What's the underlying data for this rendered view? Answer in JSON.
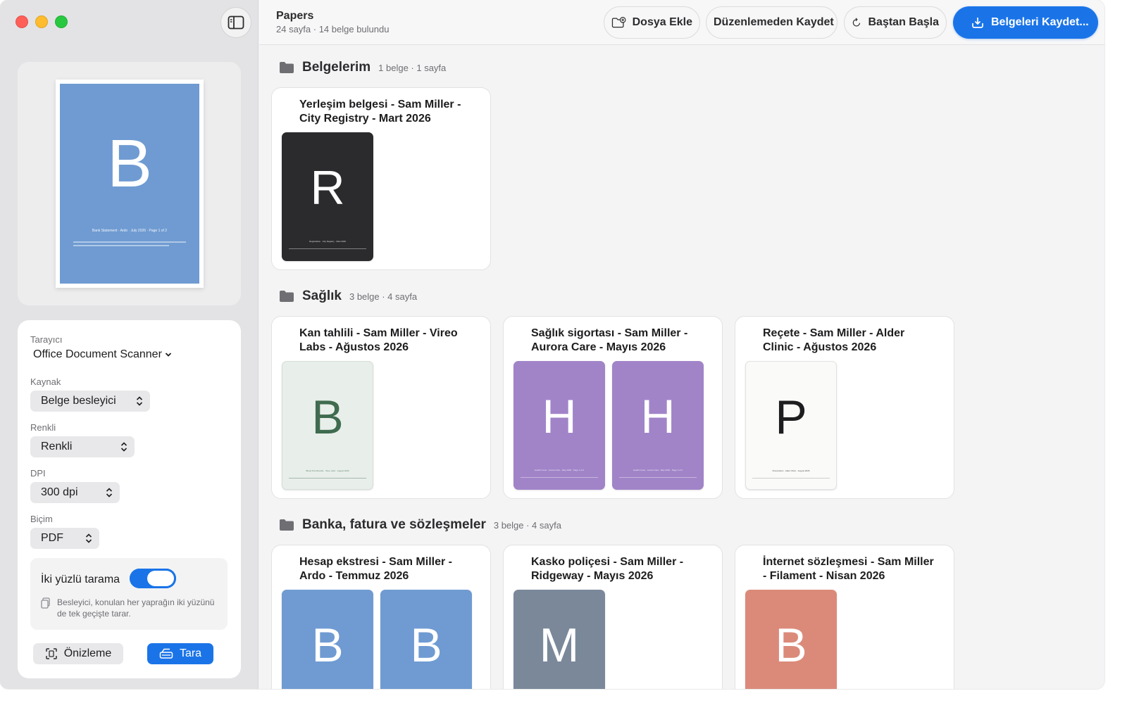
{
  "sidebar": {
    "preview": {
      "letter": "B",
      "caption": "Bank Statement · Ardo · July 2026 · Page 1 of 2",
      "color": "#6f9bd2"
    },
    "settings": {
      "scanner_label": "Tarayıcı",
      "scanner_value": "Office Document Scanner",
      "source_label": "Kaynak",
      "source_value": "Belge besleyici",
      "color_label": "Renkli",
      "color_value": "Renkli",
      "dpi_label": "DPI",
      "dpi_value": "300 dpi",
      "format_label": "Biçim",
      "format_value": "PDF",
      "duplex_label": "İki yüzlü tarama",
      "duplex_on": true,
      "duplex_hint": "Besleyici, konulan her yaprağın iki yüzünü de tek geçişte tarar.",
      "preview_button": "Önizleme",
      "scan_button": "Tara"
    }
  },
  "toolbar": {
    "title": "Papers",
    "subtitle": "24 sayfa · 14 belge bulundu",
    "add_file": "Dosya Ekle",
    "save_unedited": "Düzenlemeden Kaydet",
    "restart": "Baştan Başla",
    "save_docs": "Belgeleri Kaydet...",
    "accent": "#1a74e8"
  },
  "sections": [
    {
      "title": "Belgelerim",
      "meta": "1 belge · 1 sayfa",
      "docs": [
        {
          "title": "Yerleşim belgesi - Sam Miller - City Registry - Mart 2026",
          "pages": [
            {
              "letter": "R",
              "bg": "#2b2b2d",
              "fg": "#ffffff",
              "caption": "Registration · City Registry · Mart 2026"
            }
          ]
        }
      ]
    },
    {
      "title": "Sağlık",
      "meta": "3 belge · 4 sayfa",
      "docs": [
        {
          "title": "Kan tahlili - Sam Miller - Vireo Labs - Ağustos 2026",
          "pages": [
            {
              "letter": "B",
              "bg": "#e8eeea",
              "fg": "#3f6b4f",
              "caption": "Blood Test Results · Vireo Labs · August 2026"
            }
          ]
        },
        {
          "title": "Sağlık sigortası - Sam Miller - Aurora Care - Mayıs 2026",
          "pages": [
            {
              "letter": "H",
              "bg": "#a184c8",
              "fg": "#ffffff",
              "caption": "Health Cover · Aurora Care · May 2026 · Page 1 of 2"
            },
            {
              "letter": "H",
              "bg": "#a184c8",
              "fg": "#ffffff",
              "caption": "Health Cover · Aurora Care · May 2026 · Page 2 of 2"
            }
          ]
        },
        {
          "title": "Reçete - Sam Miller - Alder Clinic - Ağustos 2026",
          "pages": [
            {
              "letter": "P",
              "bg": "#fafaf9",
              "fg": "#1d1d1f",
              "caption": "Prescription · Alder Clinic · August 2026"
            }
          ]
        }
      ]
    },
    {
      "title": "Banka, fatura ve sözleşmeler",
      "meta": "3 belge · 4 sayfa",
      "docs": [
        {
          "title": "Hesap ekstresi - Sam Miller - Ardo - Temmuz 2026",
          "pages": [
            {
              "letter": "B",
              "bg": "#6f9bd2",
              "fg": "#ffffff",
              "caption": ""
            },
            {
              "letter": "B",
              "bg": "#6f9bd2",
              "fg": "#ffffff",
              "caption": ""
            }
          ]
        },
        {
          "title": "Kasko poliçesi - Sam Miller - Ridgeway - Mayıs 2026",
          "pages": [
            {
              "letter": "M",
              "bg": "#7a889a",
              "fg": "#ffffff",
              "caption": ""
            }
          ]
        },
        {
          "title": "İnternet sözleşmesi - Sam Miller - Filament - Nisan 2026",
          "pages": [
            {
              "letter": "B",
              "bg": "#db8a7a",
              "fg": "#ffffff",
              "caption": ""
            }
          ]
        }
      ]
    }
  ]
}
